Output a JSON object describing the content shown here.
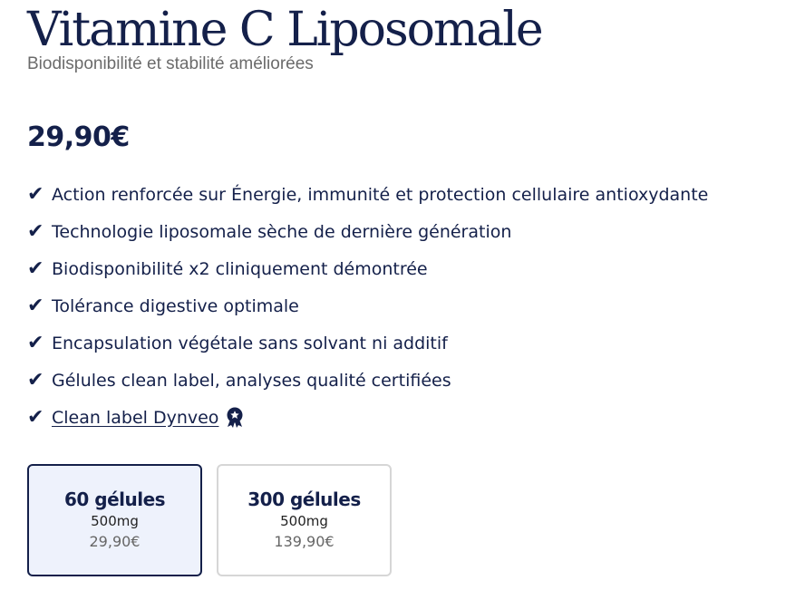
{
  "product": {
    "title": "Vitamine C Liposomale",
    "subtitle": "Biodisponibilité et stabilité améliorées",
    "price": "29,90€"
  },
  "benefits": {
    "check_glyph": "✔",
    "items": [
      "Action renforcée sur Énergie, immunité et protection cellulaire antioxydante",
      "Technologie liposomale sèche de dernière génération",
      "Biodisponibilité x2 cliniquement démontrée",
      "Tolérance digestive optimale",
      "Encapsulation végétale sans solvant ni additif",
      "Gélules clean label, analyses qualité certifiées"
    ],
    "link_label": "Clean label Dynveo",
    "badge_icon": "award-badge-icon"
  },
  "variants": [
    {
      "name": "60 gélules",
      "dose": "500mg",
      "price": "29,90€",
      "selected": true
    },
    {
      "name": "300 gélules",
      "dose": "500mg",
      "price": "139,90€",
      "selected": false
    }
  ],
  "colors": {
    "navy": "#14204a",
    "selected_bg": "#eef2fc",
    "border_gray": "#d6d6d6",
    "muted_text": "#6b6b6b"
  }
}
